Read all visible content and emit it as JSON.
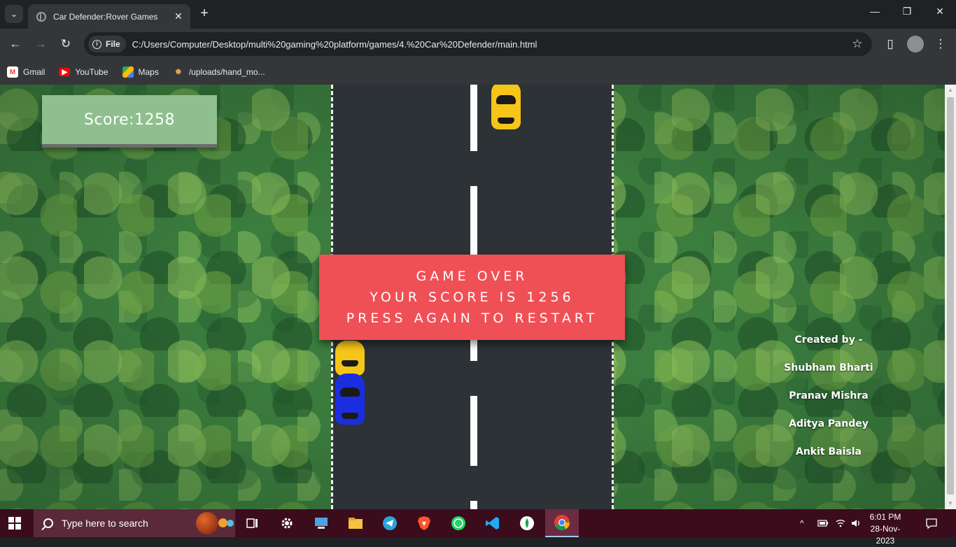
{
  "browser": {
    "tab_title": "Car Defender:Rover Games",
    "chip_label": "File",
    "url": "C:/Users/Computer/Desktop/multi%20gaming%20platform/games/4.%20Car%20Defender/main.html",
    "bookmarks": [
      {
        "label": "Gmail",
        "icon": "gmail-icon"
      },
      {
        "label": "YouTube",
        "icon": "youtube-icon"
      },
      {
        "label": "Maps",
        "icon": "maps-icon"
      },
      {
        "label": "/uploads/hand_mo...",
        "icon": "folder-icon"
      }
    ]
  },
  "game": {
    "score_label": "Score:1258",
    "gameover_line1": "GAME OVER",
    "gameover_line2": "YOUR SCORE IS 1256",
    "gameover_line3": "PRESS AGAIN TO RESTART"
  },
  "credits": {
    "heading": "Created by -",
    "names": [
      "Shubham Bharti",
      "Pranav Mishra",
      "Aditya Pandey",
      "Ankit Baisla"
    ]
  },
  "taskbar": {
    "search_placeholder": "Type here to search",
    "time": "6:01 PM",
    "date": "28-Nov-2023"
  },
  "colors": {
    "score_bg": "#8fbf8f",
    "gameover_bg": "#ef5056",
    "road": "#2c3235",
    "yellow_car": "#f5c518",
    "blue_car": "#1a2ee0",
    "taskbar": "#3b0c1c"
  }
}
